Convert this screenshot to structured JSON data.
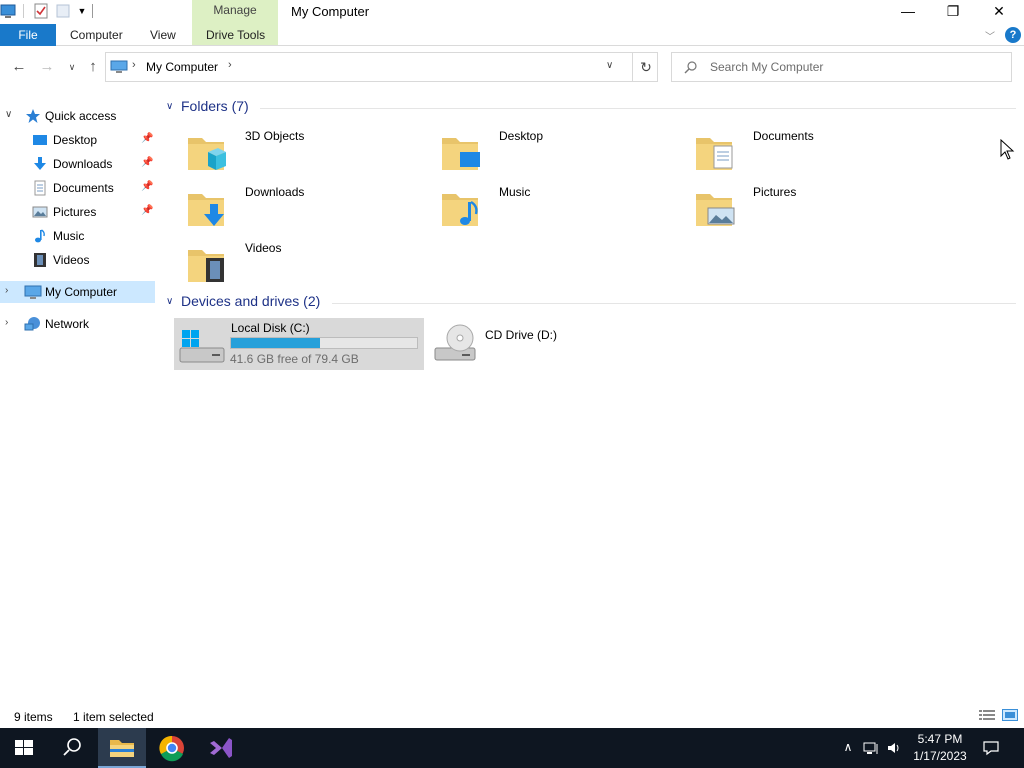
{
  "window": {
    "title": "My Computer",
    "context_tab": "Manage",
    "controls": {
      "minimize": "—",
      "maximize": "❐",
      "close": "✕"
    }
  },
  "ribbon": {
    "file": "File",
    "tabs": [
      "Computer",
      "View",
      "Drive Tools"
    ]
  },
  "address": {
    "path": "My Computer"
  },
  "search": {
    "placeholder": "Search My Computer"
  },
  "navpane": {
    "quick_access": "Quick access",
    "quick_items": [
      {
        "label": "Desktop",
        "icon": "desktop-icon",
        "pinned": true
      },
      {
        "label": "Downloads",
        "icon": "downloads-icon",
        "pinned": true
      },
      {
        "label": "Documents",
        "icon": "documents-icon",
        "pinned": true
      },
      {
        "label": "Pictures",
        "icon": "pictures-icon",
        "pinned": true
      },
      {
        "label": "Music",
        "icon": "music-icon",
        "pinned": false
      },
      {
        "label": "Videos",
        "icon": "videos-icon",
        "pinned": false
      }
    ],
    "my_computer": "My Computer",
    "network": "Network"
  },
  "content": {
    "folders_header": "Folders (7)",
    "folders": [
      {
        "label": "3D Objects",
        "icon": "3d-objects-folder-icon"
      },
      {
        "label": "Desktop",
        "icon": "desktop-folder-icon"
      },
      {
        "label": "Documents",
        "icon": "documents-folder-icon"
      },
      {
        "label": "Downloads",
        "icon": "downloads-folder-icon"
      },
      {
        "label": "Music",
        "icon": "music-folder-icon"
      },
      {
        "label": "Pictures",
        "icon": "pictures-folder-icon"
      },
      {
        "label": "Videos",
        "icon": "videos-folder-icon"
      }
    ],
    "devices_header": "Devices and drives (2)",
    "drives": [
      {
        "label": "Local Disk (C:)",
        "free_text": "41.6 GB free of 79.4 GB",
        "used_fraction": 0.476,
        "selected": true,
        "icon": "hard-drive-icon"
      },
      {
        "label": "CD Drive (D:)",
        "icon": "cd-drive-icon",
        "selected": false
      }
    ]
  },
  "status": {
    "count": "9 items",
    "selected": "1 item selected"
  },
  "taskbar": {
    "time": "5:47 PM",
    "date": "1/17/2023"
  },
  "colors": {
    "accent": "#1979ca",
    "selection": "#cce8ff",
    "manage_tab": "#ddf0c4",
    "group_header": "#1e3287",
    "drive_bar": "#26a0da",
    "taskbar": "#0e1621"
  }
}
